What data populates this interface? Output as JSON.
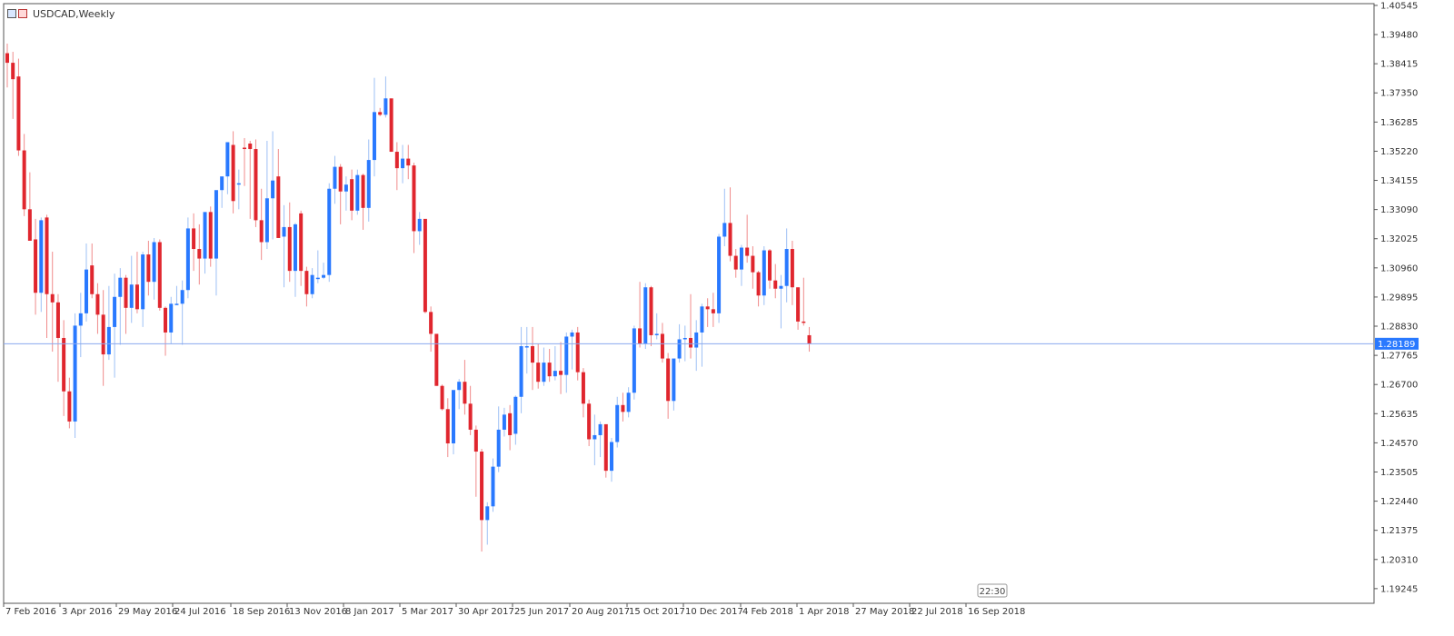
{
  "header": {
    "title": "USDCAD,Weekly"
  },
  "time_badge": "22:30",
  "colors": {
    "bull": "#2979ff",
    "bear": "#e0262e",
    "wick_bull": "#9ec0f5",
    "wick_bear": "#f08b8b",
    "price_line": "#8aa8ee",
    "price_box": "#2979ff",
    "grid_axis": "#555555"
  },
  "chart_data": {
    "type": "candlestick",
    "symbol": "USDCAD",
    "timeframe": "Weekly",
    "current_price": "1.28189",
    "ylim": [
      1.1871,
      1.4061
    ],
    "y_ticks": [
      "1.40545",
      "1.39480",
      "1.38415",
      "1.37350",
      "1.36285",
      "1.35220",
      "1.34155",
      "1.33090",
      "1.32025",
      "1.30960",
      "1.29895",
      "1.28830",
      "1.27765",
      "1.26700",
      "1.25635",
      "1.24570",
      "1.23505",
      "1.22440",
      "1.21375",
      "1.20310",
      "1.19245"
    ],
    "x_labels": [
      "7 Feb 2016",
      "3 Apr 2016",
      "29 May 2016",
      "24 Jul 2016",
      "18 Sep 2016",
      "13 Nov 2016",
      "8 Jan 2017",
      "5 Mar 2017",
      "30 Apr 2017",
      "25 Jun 2017",
      "20 Aug 2017",
      "15 Oct 2017",
      "10 Dec 2017",
      "4 Feb 2018",
      "1 Apr 2018",
      "27 May 2018",
      "22 Jul 2018",
      "16 Sep 2018"
    ],
    "candles": [
      {
        "o": 1.388,
        "h": 1.3915,
        "l": 1.3755,
        "c": 1.3845
      },
      {
        "o": 1.3845,
        "h": 1.3885,
        "l": 1.364,
        "c": 1.3785
      },
      {
        "o": 1.3795,
        "h": 1.386,
        "l": 1.3505,
        "c": 1.3525
      },
      {
        "o": 1.3525,
        "h": 1.3585,
        "l": 1.3285,
        "c": 1.331
      },
      {
        "o": 1.331,
        "h": 1.3445,
        "l": 1.32,
        "c": 1.3195
      },
      {
        "o": 1.32,
        "h": 1.3275,
        "l": 1.2925,
        "c": 1.3005
      },
      {
        "o": 1.3005,
        "h": 1.328,
        "l": 1.2935,
        "c": 1.327
      },
      {
        "o": 1.328,
        "h": 1.329,
        "l": 1.284,
        "c": 1.3
      },
      {
        "o": 1.3,
        "h": 1.3155,
        "l": 1.279,
        "c": 1.297
      },
      {
        "o": 1.297,
        "h": 1.3,
        "l": 1.268,
        "c": 1.284
      },
      {
        "o": 1.284,
        "h": 1.2905,
        "l": 1.2555,
        "c": 1.2645
      },
      {
        "o": 1.2645,
        "h": 1.2695,
        "l": 1.251,
        "c": 1.2535
      },
      {
        "o": 1.2535,
        "h": 1.293,
        "l": 1.2475,
        "c": 1.2885
      },
      {
        "o": 1.2885,
        "h": 1.3005,
        "l": 1.277,
        "c": 1.293
      },
      {
        "o": 1.293,
        "h": 1.3185,
        "l": 1.29,
        "c": 1.309
      },
      {
        "o": 1.3105,
        "h": 1.3185,
        "l": 1.2985,
        "c": 1.3
      },
      {
        "o": 1.3,
        "h": 1.304,
        "l": 1.2855,
        "c": 1.2925
      },
      {
        "o": 1.2925,
        "h": 1.3015,
        "l": 1.2665,
        "c": 1.278
      },
      {
        "o": 1.278,
        "h": 1.303,
        "l": 1.276,
        "c": 1.288
      },
      {
        "o": 1.288,
        "h": 1.3075,
        "l": 1.2695,
        "c": 1.299
      },
      {
        "o": 1.299,
        "h": 1.3095,
        "l": 1.2815,
        "c": 1.306
      },
      {
        "o": 1.306,
        "h": 1.307,
        "l": 1.2855,
        "c": 1.295
      },
      {
        "o": 1.295,
        "h": 1.314,
        "l": 1.2895,
        "c": 1.3035
      },
      {
        "o": 1.3035,
        "h": 1.3155,
        "l": 1.293,
        "c": 1.2945
      },
      {
        "o": 1.2945,
        "h": 1.3155,
        "l": 1.288,
        "c": 1.3145
      },
      {
        "o": 1.3145,
        "h": 1.3195,
        "l": 1.2995,
        "c": 1.3045
      },
      {
        "o": 1.3045,
        "h": 1.3205,
        "l": 1.298,
        "c": 1.319
      },
      {
        "o": 1.319,
        "h": 1.32,
        "l": 1.294,
        "c": 1.295
      },
      {
        "o": 1.295,
        "h": 1.2955,
        "l": 1.2775,
        "c": 1.286
      },
      {
        "o": 1.286,
        "h": 1.299,
        "l": 1.282,
        "c": 1.2965
      },
      {
        "o": 1.2965,
        "h": 1.303,
        "l": 1.296,
        "c": 1.2965
      },
      {
        "o": 1.2965,
        "h": 1.305,
        "l": 1.2815,
        "c": 1.3015
      },
      {
        "o": 1.3015,
        "h": 1.328,
        "l": 1.2985,
        "c": 1.324
      },
      {
        "o": 1.324,
        "h": 1.3295,
        "l": 1.3085,
        "c": 1.3165
      },
      {
        "o": 1.3165,
        "h": 1.3255,
        "l": 1.3035,
        "c": 1.313
      },
      {
        "o": 1.313,
        "h": 1.3265,
        "l": 1.3075,
        "c": 1.33
      },
      {
        "o": 1.33,
        "h": 1.332,
        "l": 1.31,
        "c": 1.313
      },
      {
        "o": 1.313,
        "h": 1.3345,
        "l": 1.2995,
        "c": 1.338
      },
      {
        "o": 1.338,
        "h": 1.342,
        "l": 1.3315,
        "c": 1.343
      },
      {
        "o": 1.343,
        "h": 1.3545,
        "l": 1.3365,
        "c": 1.3555
      },
      {
        "o": 1.3545,
        "h": 1.3595,
        "l": 1.3295,
        "c": 1.334
      },
      {
        "o": 1.34,
        "h": 1.3455,
        "l": 1.331,
        "c": 1.3405
      },
      {
        "o": 1.3535,
        "h": 1.357,
        "l": 1.3395,
        "c": 1.353
      },
      {
        "o": 1.355,
        "h": 1.356,
        "l": 1.3275,
        "c": 1.353
      },
      {
        "o": 1.353,
        "h": 1.3565,
        "l": 1.3245,
        "c": 1.327
      },
      {
        "o": 1.327,
        "h": 1.3385,
        "l": 1.3125,
        "c": 1.319
      },
      {
        "o": 1.319,
        "h": 1.356,
        "l": 1.3165,
        "c": 1.335
      },
      {
        "o": 1.335,
        "h": 1.3595,
        "l": 1.32,
        "c": 1.3415
      },
      {
        "o": 1.343,
        "h": 1.353,
        "l": 1.3265,
        "c": 1.3205
      },
      {
        "o": 1.321,
        "h": 1.3325,
        "l": 1.3025,
        "c": 1.3245
      },
      {
        "o": 1.3245,
        "h": 1.3335,
        "l": 1.3045,
        "c": 1.3085
      },
      {
        "o": 1.3085,
        "h": 1.326,
        "l": 1.299,
        "c": 1.3255
      },
      {
        "o": 1.3295,
        "h": 1.3305,
        "l": 1.303,
        "c": 1.3085
      },
      {
        "o": 1.3085,
        "h": 1.31,
        "l": 1.2955,
        "c": 1.3
      },
      {
        "o": 1.3,
        "h": 1.3095,
        "l": 1.2985,
        "c": 1.307
      },
      {
        "o": 1.306,
        "h": 1.316,
        "l": 1.304,
        "c": 1.306
      },
      {
        "o": 1.306,
        "h": 1.3115,
        "l": 1.3055,
        "c": 1.307
      },
      {
        "o": 1.307,
        "h": 1.3405,
        "l": 1.3045,
        "c": 1.3385
      },
      {
        "o": 1.3385,
        "h": 1.3505,
        "l": 1.333,
        "c": 1.3465
      },
      {
        "o": 1.3465,
        "h": 1.3475,
        "l": 1.3255,
        "c": 1.3375
      },
      {
        "o": 1.3375,
        "h": 1.343,
        "l": 1.3305,
        "c": 1.34
      },
      {
        "o": 1.342,
        "h": 1.3455,
        "l": 1.327,
        "c": 1.3305
      },
      {
        "o": 1.3305,
        "h": 1.3455,
        "l": 1.329,
        "c": 1.3435
      },
      {
        "o": 1.3435,
        "h": 1.344,
        "l": 1.3235,
        "c": 1.3315
      },
      {
        "o": 1.3315,
        "h": 1.3565,
        "l": 1.3265,
        "c": 1.349
      },
      {
        "o": 1.349,
        "h": 1.379,
        "l": 1.343,
        "c": 1.3665
      },
      {
        "o": 1.3665,
        "h": 1.368,
        "l": 1.365,
        "c": 1.3655
      },
      {
        "o": 1.3655,
        "h": 1.3795,
        "l": 1.3645,
        "c": 1.3715
      },
      {
        "o": 1.3715,
        "h": 1.371,
        "l": 1.352,
        "c": 1.352
      },
      {
        "o": 1.352,
        "h": 1.3555,
        "l": 1.338,
        "c": 1.346
      },
      {
        "o": 1.346,
        "h": 1.3545,
        "l": 1.3405,
        "c": 1.3495
      },
      {
        "o": 1.3495,
        "h": 1.3545,
        "l": 1.342,
        "c": 1.347
      },
      {
        "o": 1.347,
        "h": 1.348,
        "l": 1.315,
        "c": 1.323
      },
      {
        "o": 1.323,
        "h": 1.33,
        "l": 1.318,
        "c": 1.3275
      },
      {
        "o": 1.3275,
        "h": 1.327,
        "l": 1.293,
        "c": 1.2935
      },
      {
        "o": 1.2935,
        "h": 1.2955,
        "l": 1.279,
        "c": 1.2855
      },
      {
        "o": 1.2855,
        "h": 1.285,
        "l": 1.2665,
        "c": 1.2665
      },
      {
        "o": 1.2665,
        "h": 1.267,
        "l": 1.2575,
        "c": 1.258
      },
      {
        "o": 1.258,
        "h": 1.262,
        "l": 1.2405,
        "c": 1.2455
      },
      {
        "o": 1.2455,
        "h": 1.2645,
        "l": 1.2415,
        "c": 1.265
      },
      {
        "o": 1.265,
        "h": 1.269,
        "l": 1.258,
        "c": 1.268
      },
      {
        "o": 1.268,
        "h": 1.276,
        "l": 1.256,
        "c": 1.26
      },
      {
        "o": 1.26,
        "h": 1.2665,
        "l": 1.2485,
        "c": 1.2505
      },
      {
        "o": 1.2505,
        "h": 1.252,
        "l": 1.226,
        "c": 1.2425
      },
      {
        "o": 1.2425,
        "h": 1.2435,
        "l": 1.206,
        "c": 1.2175
      },
      {
        "o": 1.2175,
        "h": 1.224,
        "l": 1.2085,
        "c": 1.2225
      },
      {
        "o": 1.2225,
        "h": 1.24,
        "l": 1.2205,
        "c": 1.237
      },
      {
        "o": 1.237,
        "h": 1.259,
        "l": 1.235,
        "c": 1.2505
      },
      {
        "o": 1.2505,
        "h": 1.2585,
        "l": 1.248,
        "c": 1.256
      },
      {
        "o": 1.2565,
        "h": 1.2595,
        "l": 1.243,
        "c": 1.2485
      },
      {
        "o": 1.249,
        "h": 1.263,
        "l": 1.245,
        "c": 1.2625
      },
      {
        "o": 1.2625,
        "h": 1.288,
        "l": 1.2565,
        "c": 1.281
      },
      {
        "o": 1.281,
        "h": 1.288,
        "l": 1.271,
        "c": 1.281
      },
      {
        "o": 1.281,
        "h": 1.288,
        "l": 1.265,
        "c": 1.275
      },
      {
        "o": 1.275,
        "h": 1.282,
        "l": 1.2655,
        "c": 1.268
      },
      {
        "o": 1.268,
        "h": 1.2805,
        "l": 1.2665,
        "c": 1.275
      },
      {
        "o": 1.275,
        "h": 1.28,
        "l": 1.268,
        "c": 1.27
      },
      {
        "o": 1.27,
        "h": 1.281,
        "l": 1.2685,
        "c": 1.272
      },
      {
        "o": 1.272,
        "h": 1.2825,
        "l": 1.2635,
        "c": 1.2705
      },
      {
        "o": 1.2705,
        "h": 1.286,
        "l": 1.264,
        "c": 1.2845
      },
      {
        "o": 1.2845,
        "h": 1.287,
        "l": 1.2725,
        "c": 1.286
      },
      {
        "o": 1.286,
        "h": 1.288,
        "l": 1.2685,
        "c": 1.2715
      },
      {
        "o": 1.2715,
        "h": 1.273,
        "l": 1.255,
        "c": 1.26
      },
      {
        "o": 1.26,
        "h": 1.2615,
        "l": 1.2445,
        "c": 1.247
      },
      {
        "o": 1.247,
        "h": 1.256,
        "l": 1.2375,
        "c": 1.2485
      },
      {
        "o": 1.2485,
        "h": 1.2535,
        "l": 1.2405,
        "c": 1.2525
      },
      {
        "o": 1.2525,
        "h": 1.2515,
        "l": 1.233,
        "c": 1.2355
      },
      {
        "o": 1.2355,
        "h": 1.2475,
        "l": 1.2315,
        "c": 1.246
      },
      {
        "o": 1.246,
        "h": 1.2625,
        "l": 1.244,
        "c": 1.2595
      },
      {
        "o": 1.2595,
        "h": 1.264,
        "l": 1.2535,
        "c": 1.257
      },
      {
        "o": 1.257,
        "h": 1.266,
        "l": 1.255,
        "c": 1.264
      },
      {
        "o": 1.264,
        "h": 1.2885,
        "l": 1.2615,
        "c": 1.2875
      },
      {
        "o": 1.2875,
        "h": 1.3045,
        "l": 1.2805,
        "c": 1.282
      },
      {
        "o": 1.282,
        "h": 1.304,
        "l": 1.28,
        "c": 1.3025
      },
      {
        "o": 1.3025,
        "h": 1.303,
        "l": 1.281,
        "c": 1.285
      },
      {
        "o": 1.285,
        "h": 1.293,
        "l": 1.2835,
        "c": 1.2855
      },
      {
        "o": 1.2855,
        "h": 1.2895,
        "l": 1.275,
        "c": 1.2765
      },
      {
        "o": 1.2765,
        "h": 1.2785,
        "l": 1.2545,
        "c": 1.261
      },
      {
        "o": 1.261,
        "h": 1.2755,
        "l": 1.2575,
        "c": 1.2765
      },
      {
        "o": 1.2765,
        "h": 1.289,
        "l": 1.275,
        "c": 1.2835
      },
      {
        "o": 1.2835,
        "h": 1.2885,
        "l": 1.2755,
        "c": 1.284
      },
      {
        "o": 1.284,
        "h": 1.3,
        "l": 1.2765,
        "c": 1.2805
      },
      {
        "o": 1.2805,
        "h": 1.2905,
        "l": 1.272,
        "c": 1.286
      },
      {
        "o": 1.286,
        "h": 1.2965,
        "l": 1.2735,
        "c": 1.2955
      },
      {
        "o": 1.2955,
        "h": 1.2985,
        "l": 1.288,
        "c": 1.2945
      },
      {
        "o": 1.2945,
        "h": 1.3005,
        "l": 1.288,
        "c": 1.293
      },
      {
        "o": 1.293,
        "h": 1.322,
        "l": 1.2895,
        "c": 1.321
      },
      {
        "o": 1.321,
        "h": 1.3385,
        "l": 1.3175,
        "c": 1.326
      },
      {
        "o": 1.326,
        "h": 1.339,
        "l": 1.312,
        "c": 1.314
      },
      {
        "o": 1.314,
        "h": 1.3165,
        "l": 1.306,
        "c": 1.309
      },
      {
        "o": 1.309,
        "h": 1.318,
        "l": 1.303,
        "c": 1.317
      },
      {
        "o": 1.317,
        "h": 1.329,
        "l": 1.3115,
        "c": 1.314
      },
      {
        "o": 1.314,
        "h": 1.3175,
        "l": 1.302,
        "c": 1.308
      },
      {
        "o": 1.308,
        "h": 1.3085,
        "l": 1.2955,
        "c": 1.2995
      },
      {
        "o": 1.2995,
        "h": 1.3175,
        "l": 1.296,
        "c": 1.316
      },
      {
        "o": 1.316,
        "h": 1.3165,
        "l": 1.302,
        "c": 1.305
      },
      {
        "o": 1.305,
        "h": 1.311,
        "l": 1.2985,
        "c": 1.302
      },
      {
        "o": 1.302,
        "h": 1.307,
        "l": 1.2875,
        "c": 1.303
      },
      {
        "o": 1.303,
        "h": 1.324,
        "l": 1.297,
        "c": 1.3165
      },
      {
        "o": 1.3165,
        "h": 1.3195,
        "l": 1.296,
        "c": 1.3025
      },
      {
        "o": 1.3025,
        "h": 1.3025,
        "l": 1.287,
        "c": 1.29
      },
      {
        "o": 1.29,
        "h": 1.306,
        "l": 1.2885,
        "c": 1.2895
      },
      {
        "o": 1.285,
        "h": 1.288,
        "l": 1.279,
        "c": 1.2819
      }
    ]
  }
}
